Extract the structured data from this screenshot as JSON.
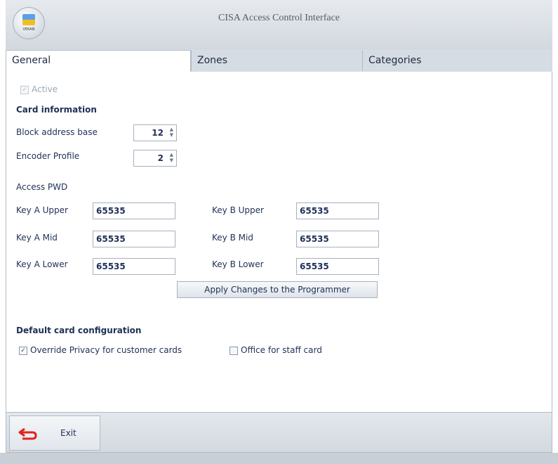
{
  "window": {
    "title": "CISA Access Control Interface",
    "logo_text": "VEKAN"
  },
  "tabs": [
    {
      "label": "General",
      "active": true
    },
    {
      "label": "Zones",
      "active": false
    },
    {
      "label": "Categories",
      "active": false
    }
  ],
  "general": {
    "active_label": "Active",
    "active_checked": true,
    "card_info_heading": "Card information",
    "block_address_label": "Block address base",
    "block_address_value": "12",
    "encoder_profile_label": "Encoder Profile",
    "encoder_profile_value": "2",
    "access_pwd_heading": "Access PWD",
    "keys": {
      "a_upper_label": "Key A Upper",
      "a_upper_value": "65535",
      "a_mid_label": "Key A Mid",
      "a_mid_value": "65535",
      "a_lower_label": "Key A Lower",
      "a_lower_value": "65535",
      "b_upper_label": "Key B Upper",
      "b_upper_value": "65535",
      "b_mid_label": "Key B Mid",
      "b_mid_value": "65535",
      "b_lower_label": "Key B Lower",
      "b_lower_value": "65535"
    },
    "apply_button": "Apply Changes to the Programmer",
    "default_config_heading": "Default card configuration",
    "override_privacy_label": "Override Privacy for customer cards",
    "override_privacy_checked": true,
    "office_staff_label": "Office for staff card",
    "office_staff_checked": false
  },
  "footer": {
    "exit_label": "Exit"
  },
  "colors": {
    "exit_icon": "#e0241b",
    "accent_text": "#1f3055"
  }
}
